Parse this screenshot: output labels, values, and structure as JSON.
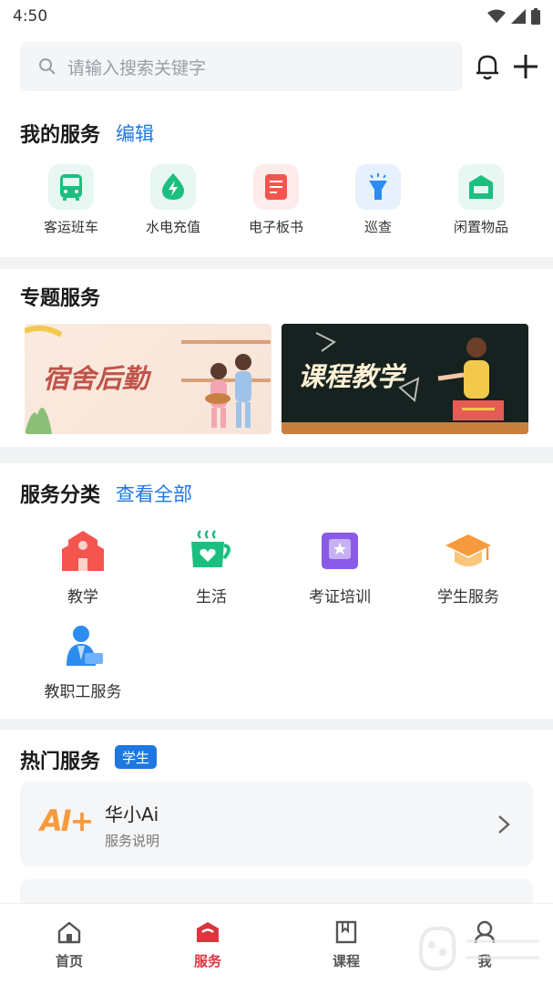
{
  "status": {
    "time": "4:50"
  },
  "search": {
    "placeholder": "请输入搜索关键字"
  },
  "my_services": {
    "title": "我的服务",
    "edit_label": "编辑",
    "items": [
      {
        "label": "客运班车",
        "icon": "bus-icon"
      },
      {
        "label": "水电充值",
        "icon": "water-electric-icon"
      },
      {
        "label": "电子板书",
        "icon": "ebook-icon"
      },
      {
        "label": "巡查",
        "icon": "flashlight-icon"
      },
      {
        "label": "闲置物品",
        "icon": "idle-items-icon"
      }
    ]
  },
  "special": {
    "title": "专题服务",
    "banners": [
      {
        "text": "宿舍后勤"
      },
      {
        "text": "课程教学"
      }
    ]
  },
  "categories": {
    "title": "服务分类",
    "view_all": "查看全部",
    "items": [
      {
        "label": "教学",
        "icon": "school-building-icon"
      },
      {
        "label": "生活",
        "icon": "coffee-cup-icon"
      },
      {
        "label": "考证培训",
        "icon": "certificate-icon"
      },
      {
        "label": "学生服务",
        "icon": "graduation-cap-icon"
      },
      {
        "label": "教职工服务",
        "icon": "staff-icon"
      }
    ]
  },
  "hot": {
    "title": "热门服务",
    "badge": "学生",
    "item": {
      "logo": "AI+",
      "title": "华小Ai",
      "subtitle": "服务说明"
    }
  },
  "tabs": [
    {
      "label": "首页",
      "icon": "home-icon"
    },
    {
      "label": "服务",
      "icon": "service-icon"
    },
    {
      "label": "课程",
      "icon": "course-icon"
    },
    {
      "label": "我",
      "icon": "profile-icon"
    }
  ],
  "colors": {
    "accent": "#1f78e0",
    "active_tab": "#d9363e",
    "green": "#1bbf80",
    "red": "#f4554f"
  }
}
